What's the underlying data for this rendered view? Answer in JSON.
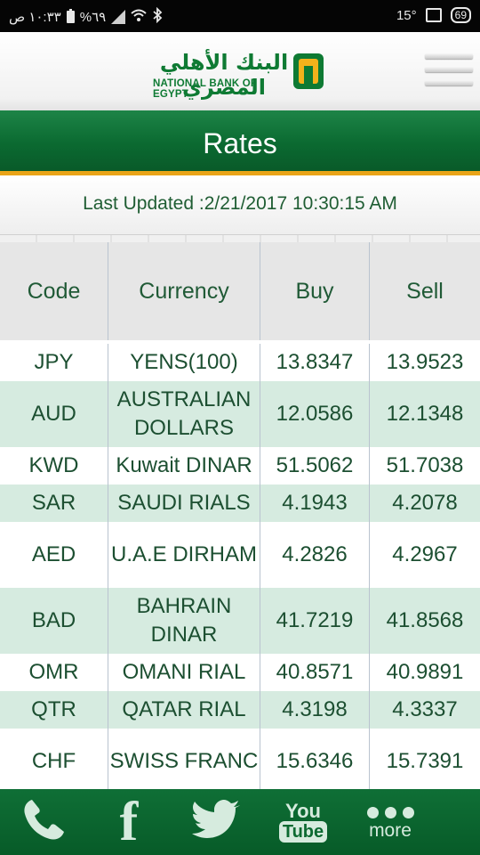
{
  "status_bar": {
    "time": "١٠:٣٣ ص",
    "battery": "%٦٩",
    "temperature": "15°",
    "notification_badge": "69"
  },
  "header": {
    "logo_arabic": "البنك الأهلي المصري",
    "logo_english": "NATIONAL BANK OF EGYPT",
    "menu_icon": "hamburger-icon"
  },
  "title": "Rates",
  "last_updated": "Last Updated :2/21/2017 10:30:15 AM",
  "table": {
    "columns": [
      "Code",
      "Currency",
      "Buy",
      "Sell"
    ],
    "rows": [
      {
        "code": "JPY",
        "currency": "YENS(100)",
        "buy": "13.8347",
        "sell": "13.9523"
      },
      {
        "code": "AUD",
        "currency": "AUSTRALIAN DOLLARS",
        "buy": "12.0586",
        "sell": "12.1348"
      },
      {
        "code": "KWD",
        "currency": "Kuwait DINAR",
        "buy": "51.5062",
        "sell": "51.7038"
      },
      {
        "code": "SAR",
        "currency": "SAUDI RIALS",
        "buy": "4.1943",
        "sell": "4.2078"
      },
      {
        "code": "AED",
        "currency": "U.A.E DIRHAM",
        "buy": "4.2826",
        "sell": "4.2967"
      },
      {
        "code": "BAD",
        "currency": "BAHRAIN DINAR",
        "buy": "41.7219",
        "sell": "41.8568"
      },
      {
        "code": "OMR",
        "currency": "OMANI RIAL",
        "buy": "40.8571",
        "sell": "40.9891"
      },
      {
        "code": "QTR",
        "currency": "QATAR RIAL",
        "buy": "4.3198",
        "sell": "4.3337"
      },
      {
        "code": "CHF",
        "currency": "SWISS FRANC",
        "buy": "15.6346",
        "sell": "15.7391"
      }
    ]
  },
  "bottom_nav": {
    "facebook_glyph": "f",
    "youtube_you": "You",
    "youtube_tube": "Tube",
    "more_label": "more"
  },
  "colors": {
    "brand_green": "#0b6a31",
    "accent_orange": "#e9a418",
    "row_alt": "#d6ebe0",
    "text_green": "#1c4f31"
  }
}
